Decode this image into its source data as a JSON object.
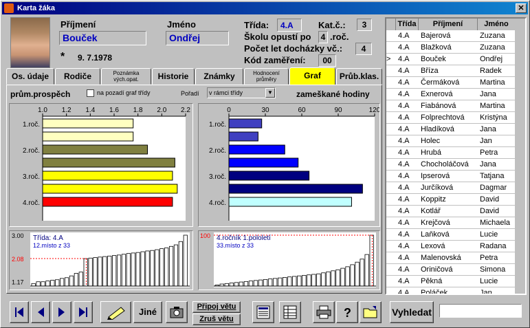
{
  "window": {
    "title": "Karta žáka"
  },
  "student": {
    "surname_label": "Příjmení",
    "surname": "Bouček",
    "name_label": "Jméno",
    "name": "Ondřej",
    "birth_mark": "*",
    "birth_date": "9. 7.1978"
  },
  "info": {
    "class_label": "Třída:",
    "class_value": "4.A",
    "cat_label": "Kat.č.:",
    "cat_value": "3",
    "leave_label": "Školu opustí po",
    "leave_value": "4",
    "leave_suffix": ".roč.",
    "years_label": "Počet let docházky vč.:",
    "years_value": "4",
    "focus_label": "Kód zaměření:",
    "focus_value": "00"
  },
  "tabs": [
    {
      "label": "Os. údaje"
    },
    {
      "label": "Rodiče"
    },
    {
      "label": "Poznámka vých.opat."
    },
    {
      "label": "Historie"
    },
    {
      "label": "Známky"
    },
    {
      "label": "Hodnocení průměry"
    },
    {
      "label": "Graf"
    },
    {
      "label": "Průb.klas."
    }
  ],
  "graph_panel": {
    "left_title": "prům.prospěch",
    "checkbox_label": "na pozadí graf třídy",
    "order_label": "Pořadí",
    "order_value": "v rámci třídy",
    "right_title": "zameškané hodiny"
  },
  "chart_data": [
    {
      "type": "bar",
      "orientation": "horizontal",
      "x_ticks": [
        "1.0",
        "1.2",
        "1.4",
        "1.6",
        "1.8",
        "2.0",
        "2.2"
      ],
      "xlim": [
        1.0,
        2.2
      ],
      "categories": [
        "1.roč.",
        "2.roč.",
        "3.roč.",
        "4.roč."
      ],
      "bars": [
        {
          "value": 1.76,
          "color": "#ffffc0"
        },
        {
          "value": 1.76,
          "color": "#ffffc0"
        },
        {
          "value": 1.88,
          "color": "#808040"
        },
        {
          "value": 2.11,
          "color": "#808040"
        },
        {
          "value": 2.09,
          "color": "#ffff00"
        },
        {
          "value": 2.13,
          "color": "#ffff00"
        },
        {
          "value": 2.09,
          "color": "#ff0000"
        }
      ]
    },
    {
      "type": "bar",
      "orientation": "horizontal",
      "x_ticks": [
        "0",
        "30",
        "60",
        "90",
        "120"
      ],
      "xlim": [
        0,
        120
      ],
      "categories": [
        "1.roč.",
        "2.roč.",
        "3.roč.",
        "4.roč."
      ],
      "bars": [
        {
          "value": 27,
          "color": "#4040c0"
        },
        {
          "value": 24,
          "color": "#4040c0"
        },
        {
          "value": 46,
          "color": "#0000ff"
        },
        {
          "value": 57,
          "color": "#0000ff"
        },
        {
          "value": 66,
          "color": "#000080"
        },
        {
          "value": 110,
          "color": "#000080"
        },
        {
          "value": 101,
          "color": "#c0ffff"
        }
      ]
    },
    {
      "type": "bar",
      "y_ticks": [
        "3.00",
        "2.08",
        "1.17"
      ],
      "ylim": [
        1.0,
        3.0
      ],
      "label_class": "Třída: 4.A",
      "label_rank": "12.místo  z 33",
      "highlight_index": 11,
      "values": [
        1.1,
        1.17,
        1.17,
        1.2,
        1.23,
        1.25,
        1.3,
        1.33,
        1.4,
        1.5,
        1.55,
        2.08,
        2.1,
        2.12,
        2.14,
        2.16,
        2.18,
        2.2,
        2.22,
        2.25,
        2.28,
        2.3,
        2.32,
        2.35,
        2.38,
        2.4,
        2.43,
        2.47,
        2.5,
        2.56,
        2.62,
        2.75,
        3.0
      ]
    },
    {
      "type": "bar",
      "y_ticks": [
        "100"
      ],
      "ylim": [
        0,
        100
      ],
      "label_class": "4.ročník 1.pololetí",
      "label_rank": "33.místo  z 33",
      "highlight_index": 32,
      "values": [
        2,
        4,
        5,
        6,
        7,
        8,
        9,
        10,
        11,
        12,
        13,
        14,
        15,
        16,
        17,
        18,
        19,
        20,
        21,
        22,
        23,
        24,
        26,
        28,
        30,
        32,
        35,
        38,
        42,
        47,
        53,
        62,
        100
      ]
    }
  ],
  "table": {
    "headers": [
      "Třída",
      "Příjmení",
      "Jméno"
    ],
    "rows": [
      {
        "cls": "4.A",
        "surname": "Bajerová",
        "name": "Zuzana",
        "marker": ""
      },
      {
        "cls": "4.A",
        "surname": "Blažková",
        "name": "Zuzana",
        "marker": ""
      },
      {
        "cls": "4.A",
        "surname": "Bouček",
        "name": "Ondřej",
        "marker": ">"
      },
      {
        "cls": "4.A",
        "surname": "Bříza",
        "name": "Radek",
        "marker": ""
      },
      {
        "cls": "4.A",
        "surname": "Čermáková",
        "name": "Martina",
        "marker": ""
      },
      {
        "cls": "4.A",
        "surname": "Exnerová",
        "name": "Jana",
        "marker": ""
      },
      {
        "cls": "4.A",
        "surname": "Fiabánová",
        "name": "Martina",
        "marker": ""
      },
      {
        "cls": "4.A",
        "surname": "Folprechtová",
        "name": "Kristýna",
        "marker": ""
      },
      {
        "cls": "4.A",
        "surname": "Hladíková",
        "name": "Jana",
        "marker": ""
      },
      {
        "cls": "4.A",
        "surname": "Holec",
        "name": "Jan",
        "marker": ""
      },
      {
        "cls": "4.A",
        "surname": "Hrubá",
        "name": "Petra",
        "marker": ""
      },
      {
        "cls": "4.A",
        "surname": "Chocholáčová",
        "name": "Jana",
        "marker": ""
      },
      {
        "cls": "4.A",
        "surname": "Ipserová",
        "name": "Tatjana",
        "marker": ""
      },
      {
        "cls": "4.A",
        "surname": "Jurčíková",
        "name": "Dagmar",
        "marker": ""
      },
      {
        "cls": "4.A",
        "surname": "Koppitz",
        "name": "David",
        "marker": ""
      },
      {
        "cls": "4.A",
        "surname": "Kotlář",
        "name": "David",
        "marker": ""
      },
      {
        "cls": "4.A",
        "surname": "Krejčová",
        "name": "Michaela",
        "marker": ""
      },
      {
        "cls": "4.A",
        "surname": "Laňková",
        "name": "Lucie",
        "marker": ""
      },
      {
        "cls": "4.A",
        "surname": "Lexová",
        "name": "Radana",
        "marker": ""
      },
      {
        "cls": "4.A",
        "surname": "Malenovská",
        "name": "Petra",
        "marker": ""
      },
      {
        "cls": "4.A",
        "surname": "Oriničová",
        "name": "Simona",
        "marker": ""
      },
      {
        "cls": "4.A",
        "surname": "Pěkná",
        "name": "Lucie",
        "marker": ""
      },
      {
        "cls": "4.A",
        "surname": "Poláček",
        "name": "Jan",
        "marker": ""
      }
    ]
  },
  "bottom": {
    "other_label": "Jiné",
    "attach_label": "Připoj větu",
    "cancel_label": "Zruš větu",
    "search_label": "Vyhledat"
  }
}
